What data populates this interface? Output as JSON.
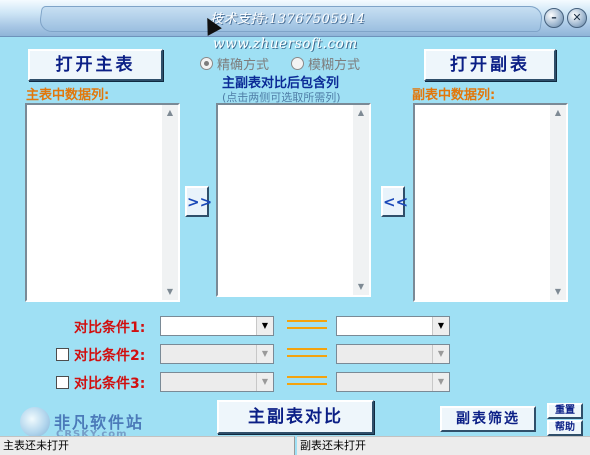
{
  "titlebar": {
    "tech_support": "技术支持:13767505914",
    "website": "www.zhuersoft.com",
    "minimize_icon": "minimize-icon",
    "close_icon": "close-icon"
  },
  "buttons": {
    "open_master": "打开主表",
    "open_sub": "打开副表",
    "compare": "主副表对比",
    "sub_filter": "副表筛选",
    "reset": "重置",
    "help": "帮助",
    "move_right": ">>",
    "move_left": "<<"
  },
  "modes": {
    "exact": "精确方式",
    "fuzzy": "模糊方式",
    "selected": "exact"
  },
  "labels": {
    "master_columns": "主表中数据列:",
    "sub_columns": "副表中数据列:",
    "result_columns": "主副表对比后包含列",
    "result_hint": "(点击两侧可选取所需列)"
  },
  "conditions": [
    {
      "label": "对比条件1:",
      "has_checkbox": false,
      "enabled": true,
      "left_value": "",
      "right_value": ""
    },
    {
      "label": "对比条件2:",
      "has_checkbox": true,
      "enabled": false,
      "left_value": "",
      "right_value": ""
    },
    {
      "label": "对比条件3:",
      "has_checkbox": true,
      "enabled": false,
      "left_value": "",
      "right_value": ""
    }
  ],
  "status": {
    "master": "主表还未打开",
    "sub": "副表还未打开"
  },
  "watermark": {
    "line1": "非凡软件站",
    "line2": "CRSKY.com"
  }
}
